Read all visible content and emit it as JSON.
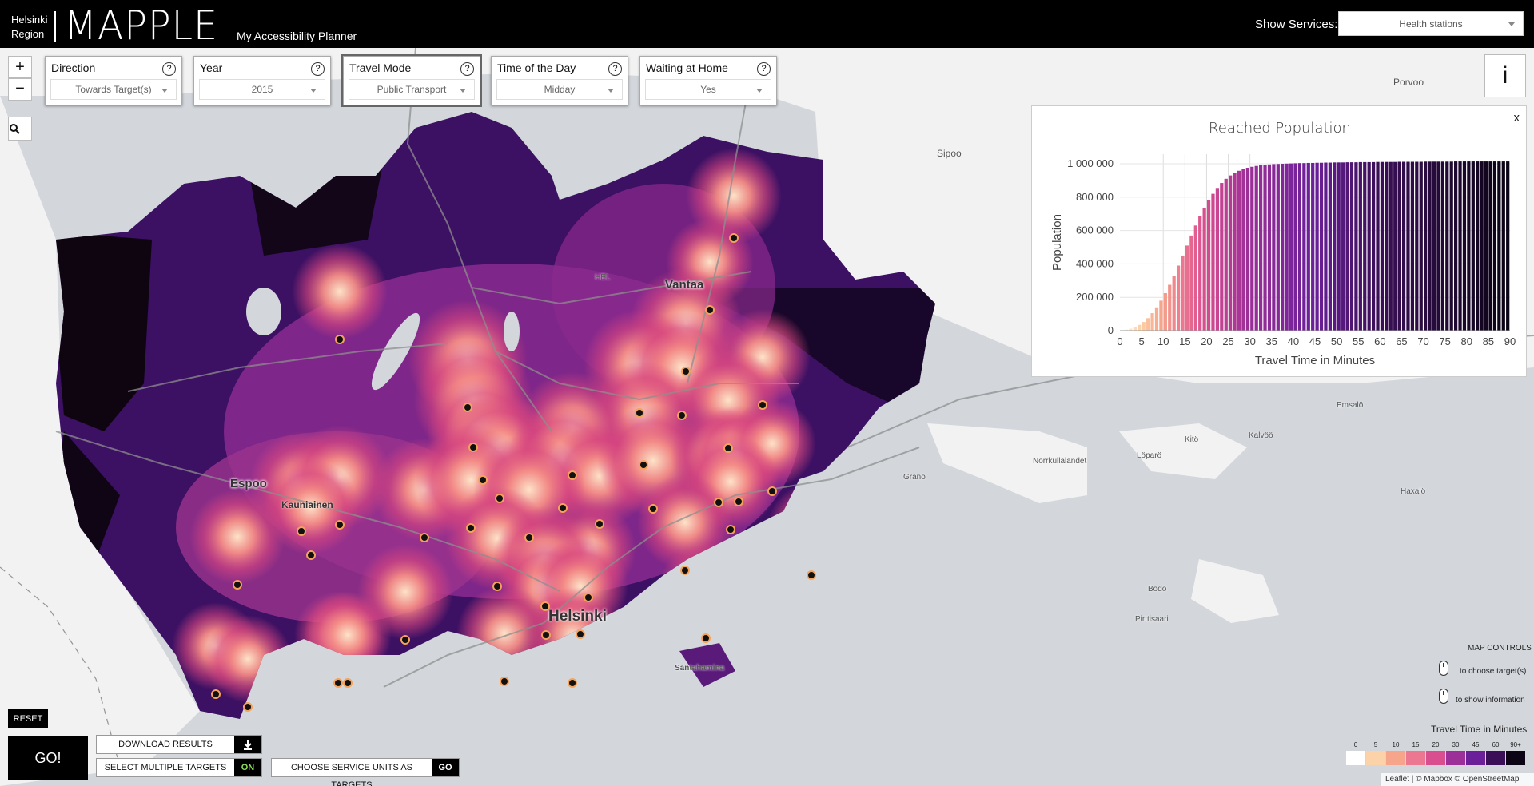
{
  "header": {
    "region_label": "Helsinki Region",
    "app_name": "MAPPLE",
    "tagline": "My Accessibility Planner",
    "services_label": "Show Services:",
    "services_value": "Health stations"
  },
  "map_controls": {
    "zoom_in": "+",
    "zoom_out": "−",
    "info": "i"
  },
  "panels": [
    {
      "label": "Direction",
      "value": "Towards Target(s)",
      "help": "?"
    },
    {
      "label": "Year",
      "value": "2015",
      "help": "?"
    },
    {
      "label": "Travel Mode",
      "value": "Public Transport",
      "help": "?"
    },
    {
      "label": "Time of the Day",
      "value": "Midday",
      "help": "?"
    },
    {
      "label": "Waiting at Home",
      "value": "Yes",
      "help": "?"
    }
  ],
  "places": {
    "cities": [
      "Espoo",
      "Vantaa",
      "Helsinki"
    ],
    "minor": [
      "Kauniainen",
      "Sipoo",
      "Porvoo",
      "HEL",
      "Santahamina",
      "Norrkullalandet",
      "Emsalö",
      "Kalvöö",
      "Löparö",
      "Kitö",
      "Granö",
      "Pirttisaari",
      "Bodö",
      "Haxalö"
    ]
  },
  "chart_data": {
    "type": "bar",
    "title": "Reached Population",
    "xlabel": "Travel Time in Minutes",
    "ylabel": "Population",
    "xlim": [
      0,
      90
    ],
    "ylim": [
      0,
      1000000
    ],
    "x_ticks": [
      "0",
      "5",
      "10",
      "15",
      "20",
      "25",
      "30",
      "35",
      "40",
      "45",
      "50",
      "55",
      "60",
      "65",
      "70",
      "75",
      "80",
      "85",
      "90"
    ],
    "y_ticks": [
      "0",
      "200 000",
      "400 000",
      "600 000",
      "800 000",
      "1 000 000"
    ],
    "x": [
      1,
      2,
      3,
      4,
      5,
      6,
      7,
      8,
      9,
      10,
      11,
      12,
      13,
      14,
      15,
      16,
      17,
      18,
      19,
      20,
      21,
      22,
      23,
      24,
      25,
      26,
      27,
      28,
      29,
      30,
      31,
      32,
      33,
      34,
      35,
      36,
      37,
      38,
      39,
      40,
      41,
      42,
      43,
      44,
      45,
      46,
      47,
      48,
      49,
      50,
      51,
      52,
      53,
      54,
      55,
      56,
      57,
      58,
      59,
      60,
      61,
      62,
      63,
      64,
      65,
      66,
      67,
      68,
      69,
      70,
      71,
      72,
      73,
      74,
      75,
      76,
      77,
      78,
      79,
      80,
      81,
      82,
      83,
      84,
      85,
      86,
      87,
      88,
      89,
      90
    ],
    "values": [
      2000,
      6000,
      12000,
      22000,
      35000,
      52000,
      75000,
      105000,
      140000,
      180000,
      225000,
      275000,
      330000,
      390000,
      450000,
      510000,
      570000,
      630000,
      685000,
      735000,
      780000,
      820000,
      855000,
      885000,
      910000,
      930000,
      945000,
      958000,
      968000,
      976000,
      982000,
      987000,
      991000,
      994000,
      996000,
      998000,
      999000,
      1000000,
      1001000,
      1002000,
      1003000,
      1004000,
      1004000,
      1005000,
      1005000,
      1006000,
      1006000,
      1007000,
      1007000,
      1008000,
      1008000,
      1008000,
      1009000,
      1009000,
      1009000,
      1010000,
      1010000,
      1010000,
      1010000,
      1011000,
      1011000,
      1011000,
      1011000,
      1011000,
      1012000,
      1012000,
      1012000,
      1012000,
      1012000,
      1012000,
      1013000,
      1013000,
      1013000,
      1013000,
      1013000,
      1013000,
      1013000,
      1014000,
      1014000,
      1014000,
      1014000,
      1014000,
      1014000,
      1014000,
      1014000,
      1014000,
      1014000,
      1014000,
      1014000,
      1014000
    ],
    "grid": true,
    "legend": "none"
  },
  "chart_close": "x",
  "bottom_controls": {
    "reset": "RESET",
    "go": "GO!",
    "download": "DOWNLOAD RESULTS",
    "download_icon": "download-icon",
    "multiple_targets": "SELECT MULTIPLE TARGETS",
    "multiple_targets_state": "ON",
    "service_units": "CHOOSE SERVICE UNITS AS TARGETS",
    "service_units_go": "GO"
  },
  "map_help": {
    "title": "MAP CONTROLS",
    "choose": "to choose target(s)",
    "info": "to show information"
  },
  "legend": {
    "title": "Travel Time in Minutes",
    "labels": [
      "0",
      "5",
      "10",
      "15",
      "20",
      "30",
      "45",
      "60",
      "90+"
    ],
    "colors": [
      "#ffffff",
      "#fcd2a8",
      "#f6a48a",
      "#ec7791",
      "#d94e8e",
      "#9d2f98",
      "#6b1f99",
      "#3b0f58",
      "#0a0414"
    ]
  },
  "attribution": "Leaflet | © Mapbox © OpenStreetMap"
}
